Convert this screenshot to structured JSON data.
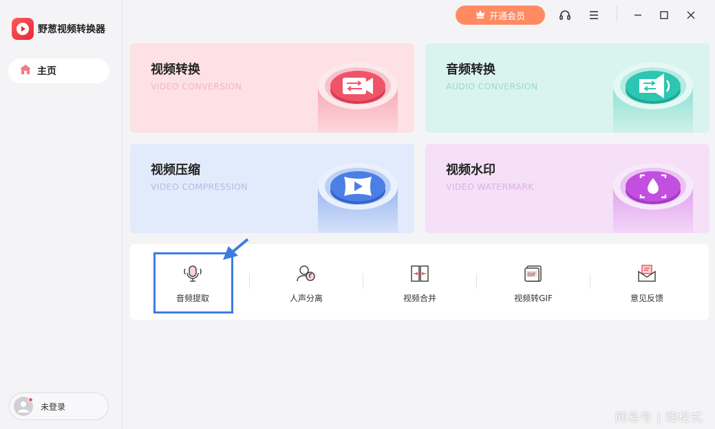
{
  "app": {
    "name": "野葱视频转换器"
  },
  "sidebar": {
    "home_label": "主页",
    "login_label": "未登录"
  },
  "titlebar": {
    "vip_label": "开通会员"
  },
  "cards": [
    {
      "title": "视频转换",
      "subtitle": "VIDEO CONVERSION",
      "icon": "video-convert-icon",
      "color": "#f05468"
    },
    {
      "title": "音频转换",
      "subtitle": "AUDIO CONVERSION",
      "icon": "audio-convert-icon",
      "color": "#2cc6b2"
    },
    {
      "title": "视频压缩",
      "subtitle": "VIDEO COMPRESSION",
      "icon": "video-compress-icon",
      "color": "#4b7fe6"
    },
    {
      "title": "视频水印",
      "subtitle": "VIDEO WATERMARK",
      "icon": "video-watermark-icon",
      "color": "#c24fe0"
    }
  ],
  "tools": [
    {
      "label": "音频提取",
      "icon": "microphone-icon"
    },
    {
      "label": "人声分离",
      "icon": "voice-separate-icon"
    },
    {
      "label": "视频合并",
      "icon": "video-merge-icon"
    },
    {
      "label": "视频转GIF",
      "icon": "gif-icon"
    },
    {
      "label": "意见反馈",
      "icon": "feedback-mail-icon"
    }
  ],
  "watermark": "网易号 | 嗨格式"
}
